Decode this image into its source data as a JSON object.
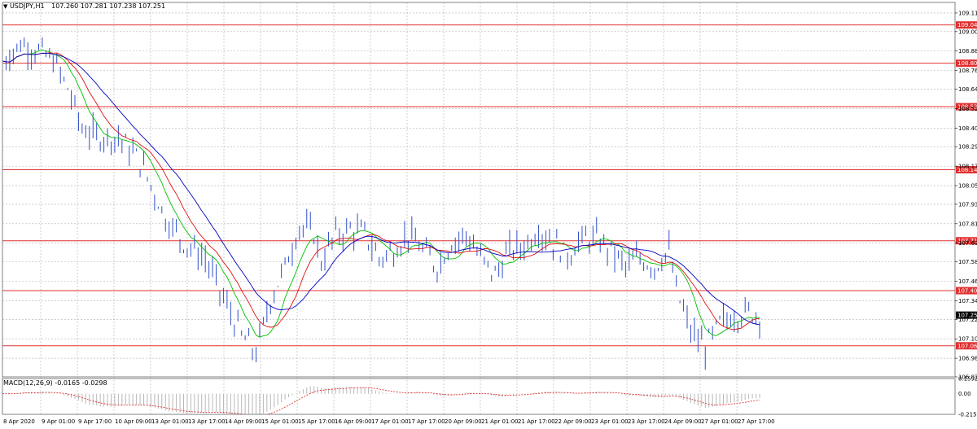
{
  "header": {
    "symbol": "USDJPY,H1",
    "ohlc": "107.260 107.281 107.238 107.251"
  },
  "macd": {
    "label": "MACD(12,26,9) -0.0165 -0.0298",
    "ticks": [
      "0.1592",
      "0.00",
      "-0.2155"
    ]
  },
  "chart_data": {
    "type": "line",
    "title": "USDJPY,H1",
    "price_ticks": [
      109.115,
      109.0,
      108.88,
      108.76,
      108.645,
      108.525,
      108.405,
      108.29,
      108.17,
      108.05,
      107.935,
      107.815,
      107.695,
      107.58,
      107.46,
      107.34,
      107.225,
      107.105,
      106.985,
      106.87
    ],
    "ylim": [
      106.87,
      109.18
    ],
    "x_ticks": [
      "8 Apr 2020",
      "9 Apr 01:00",
      "9 Apr 17:00",
      "10 Apr 09:00",
      "13 Apr 01:00",
      "13 Apr 17:00",
      "14 Apr 09:00",
      "15 Apr 01:00",
      "15 Apr 17:00",
      "16 Apr 09:00",
      "17 Apr 01:00",
      "17 Apr 17:00",
      "20 Apr 09:00",
      "21 Apr 01:00",
      "21 Apr 17:00",
      "22 Apr 09:00",
      "23 Apr 01:00",
      "23 Apr 17:00",
      "24 Apr 09:00",
      "27 Apr 01:00",
      "27 Apr 17:00"
    ],
    "horizontal_levels": [
      {
        "value": "109.041",
        "y": 109.041
      },
      {
        "value": "108.805",
        "y": 108.805
      },
      {
        "value": "108.537",
        "y": 108.537
      },
      {
        "value": "108.148",
        "y": 108.148
      },
      {
        "value": "107.710",
        "y": 107.71
      },
      {
        "value": "107.402",
        "y": 107.402
      },
      {
        "value": "107.062",
        "y": 107.062
      }
    ],
    "current_price": "107.251",
    "price_anchors": [
      [
        0,
        108.82
      ],
      [
        5,
        108.92
      ],
      [
        10,
        108.88
      ],
      [
        14,
        108.82
      ],
      [
        18,
        108.65
      ],
      [
        22,
        108.4
      ],
      [
        26,
        108.35
      ],
      [
        32,
        108.35
      ],
      [
        38,
        108.2
      ],
      [
        45,
        107.85
      ],
      [
        50,
        107.7
      ],
      [
        56,
        107.6
      ],
      [
        60,
        107.4
      ],
      [
        66,
        107.12
      ],
      [
        70,
        107.02
      ],
      [
        74,
        107.35
      ],
      [
        78,
        107.55
      ],
      [
        82,
        107.8
      ],
      [
        86,
        107.75
      ],
      [
        88,
        107.58
      ],
      [
        92,
        107.75
      ],
      [
        96,
        107.78
      ],
      [
        100,
        107.75
      ],
      [
        104,
        107.6
      ],
      [
        108,
        107.65
      ],
      [
        112,
        107.75
      ],
      [
        116,
        107.65
      ],
      [
        120,
        107.55
      ],
      [
        124,
        107.7
      ],
      [
        128,
        107.75
      ],
      [
        132,
        107.6
      ],
      [
        136,
        107.5
      ],
      [
        140,
        107.65
      ],
      [
        144,
        107.68
      ],
      [
        148,
        107.78
      ],
      [
        152,
        107.7
      ],
      [
        156,
        107.62
      ],
      [
        160,
        107.72
      ],
      [
        164,
        107.72
      ],
      [
        168,
        107.65
      ],
      [
        172,
        107.55
      ],
      [
        176,
        107.6
      ],
      [
        180,
        107.55
      ],
      [
        184,
        107.65
      ],
      [
        186,
        107.4
      ],
      [
        190,
        107.15
      ],
      [
        194,
        107.05
      ],
      [
        198,
        107.2
      ],
      [
        202,
        107.25
      ],
      [
        206,
        107.27
      ],
      [
        209,
        107.251
      ]
    ],
    "series": [
      {
        "type": "price",
        "color": "#3050c8"
      },
      {
        "type": "ma-fast",
        "color": "#00c000",
        "period": 8
      },
      {
        "type": "ma-mid",
        "color": "#e01010",
        "period": 13
      },
      {
        "type": "ma-slow",
        "color": "#0000c0",
        "period": 21
      }
    ],
    "grid": true
  }
}
